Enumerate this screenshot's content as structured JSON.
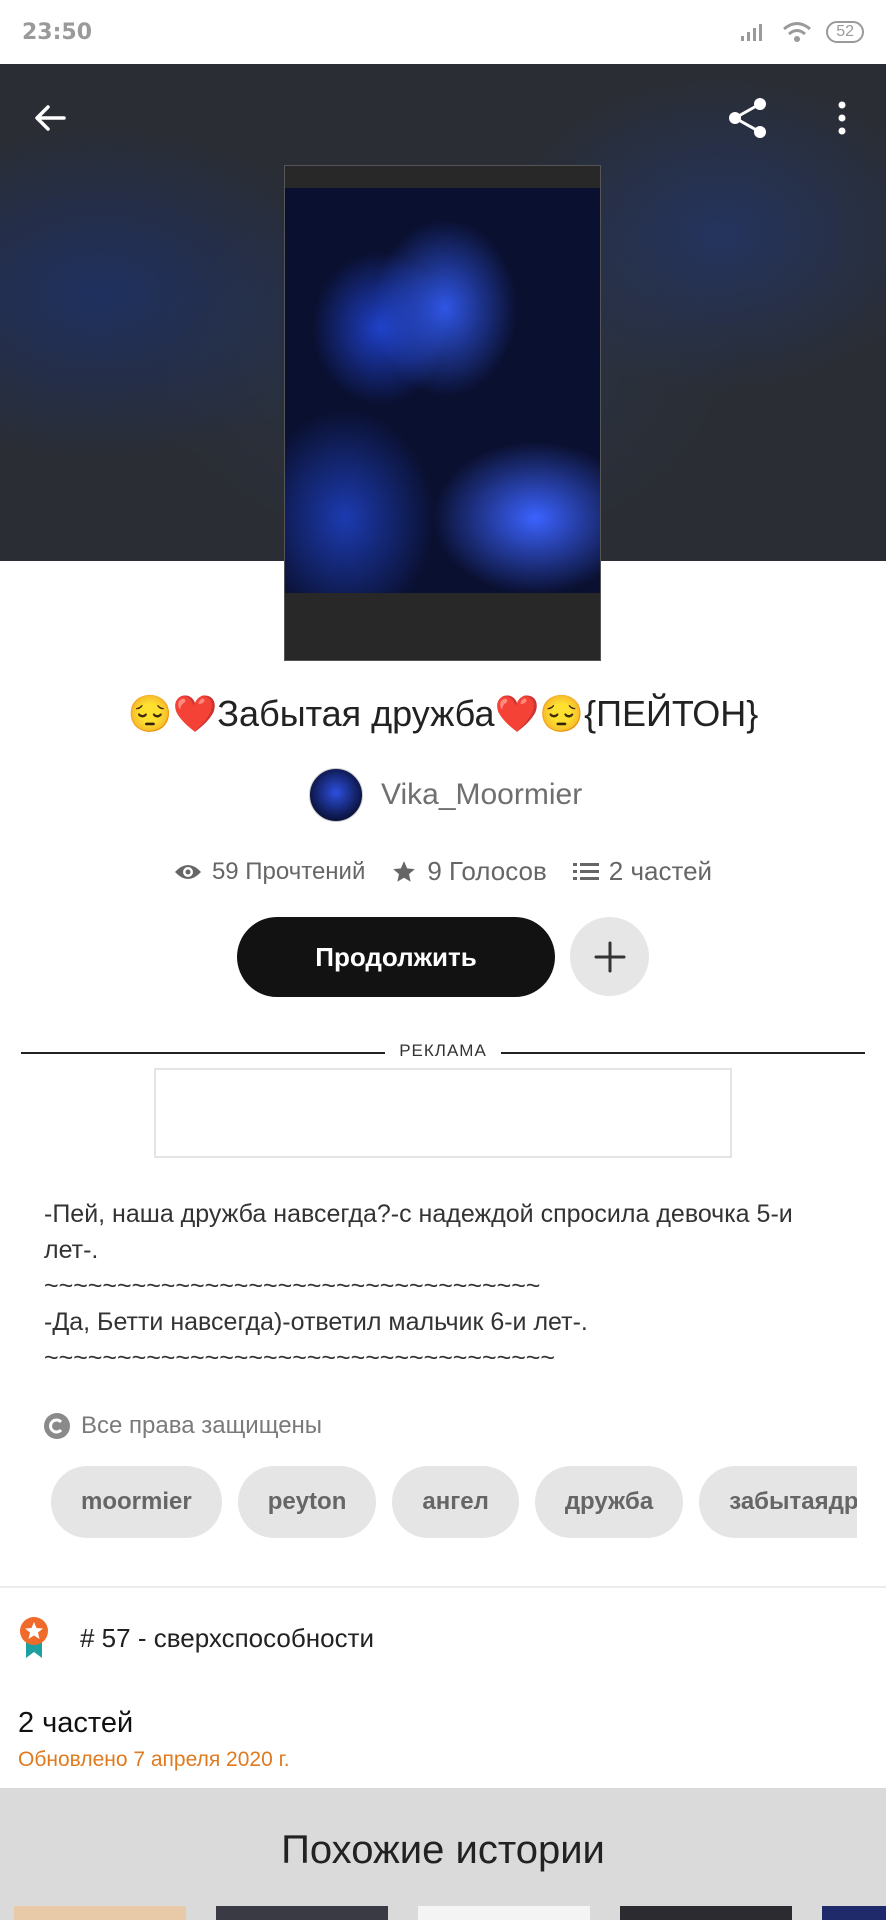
{
  "status_bar": {
    "time": "23:50",
    "battery": "52"
  },
  "story": {
    "title": "😔❤️Забытая дружба❤️😔{ПЕЙТОН}",
    "author": "Vika_Moormier",
    "stats": {
      "reads": "59 Прочтений",
      "votes": "9 Голосов",
      "parts": "2 частей"
    },
    "continue_label": "Продолжить",
    "ad_label": "РЕКЛАМА",
    "description": [
      "-Пей, наша дружба навсегда?-с надеждой спросила девочка 5-и лет-.",
      "~~~~~~~~~~~~~~~~~~~~~~~~~~~~~~~~~~",
      "-Да, Бетти навсегда)-ответил мальчик 6-и лет-.",
      "~~~~~~~~~~~~~~~~~~~~~~~~~~~~~~~~~~~"
    ],
    "copyright": "Все права защищены",
    "tags": [
      "moormier",
      "peyton",
      "ангел",
      "дружба",
      "забытаядр"
    ],
    "rank": "# 57 - сверхспособности",
    "parts_count": "2 частей",
    "updated": "Обновлено 7 апреля 2020 г."
  },
  "similar": {
    "title": "Похожие истории"
  },
  "icons": {
    "back": "arrow-left-icon",
    "share": "share-icon",
    "more": "more-vertical-icon",
    "eye": "eye-icon",
    "star": "star-icon",
    "list": "list-icon",
    "plus": "plus-icon",
    "copyright": "copyright-icon",
    "award": "award-ribbon-icon"
  },
  "colors": {
    "accent": "#e07a1f",
    "button": "#121212",
    "tag_bg": "#e5e5e5"
  }
}
